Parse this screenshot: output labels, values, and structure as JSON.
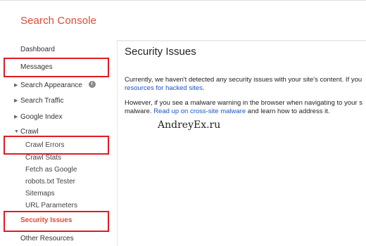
{
  "header": {
    "app_title": "Search Console"
  },
  "sidebar": {
    "items": [
      {
        "label": "Dashboard"
      },
      {
        "label": "Messages"
      },
      {
        "label": "Search Appearance"
      },
      {
        "label": "Search Traffic"
      },
      {
        "label": "Google Index"
      },
      {
        "label": "Crawl"
      },
      {
        "label": "Crawl Errors"
      },
      {
        "label": "Crawl Stats"
      },
      {
        "label": "Fetch as Google"
      },
      {
        "label": "robots.txt Tester"
      },
      {
        "label": "Sitemaps"
      },
      {
        "label": "URL Parameters"
      },
      {
        "label": "Security Issues"
      },
      {
        "label": "Other Resources"
      }
    ],
    "info_icon_glyph": "i"
  },
  "main": {
    "title": "Security Issues",
    "para1_text": "Currently, we haven't detected any security issues with your site's content. If you",
    "para1_link": "resources for hacked sites",
    "para1_end": ".",
    "para2_text": "However, if you see a malware warning in the browser when navigating to your s",
    "para2_prefix": "malware.",
    "para2_link": "Read up on cross-site malware",
    "para2_suffix": "and learn how to address it."
  },
  "watermark": "AndreyEx.ru",
  "colors": {
    "brand_red": "#dd4b39",
    "highlight_red": "#e01b24",
    "link_blue": "#1a55c4"
  }
}
